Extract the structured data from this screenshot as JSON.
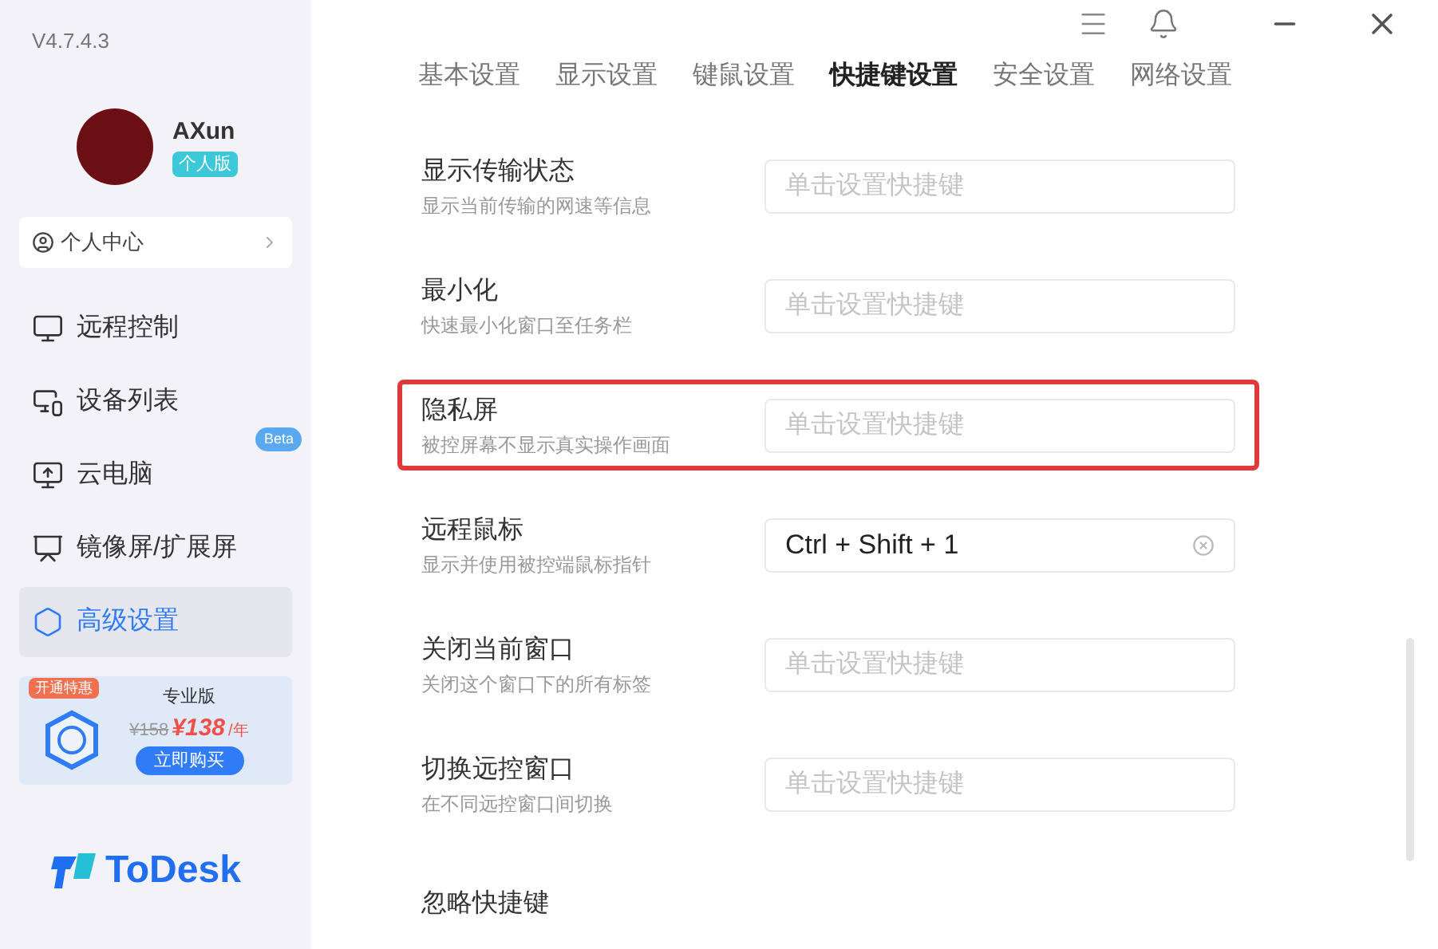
{
  "version": "V4.7.4.3",
  "user": {
    "name": "AXun",
    "badge": "个人版"
  },
  "personal_center": {
    "label": "个人中心"
  },
  "nav": [
    {
      "label": "远程控制",
      "selected": false
    },
    {
      "label": "设备列表",
      "selected": false
    },
    {
      "label": "云电脑",
      "selected": false,
      "badge": "Beta"
    },
    {
      "label": "镜像屏/扩展屏",
      "selected": false
    },
    {
      "label": "高级设置",
      "selected": true
    }
  ],
  "promo": {
    "tag": "开通特惠",
    "title": "专业版",
    "old_price": "¥158",
    "price": "¥138",
    "unit": "/年",
    "button": "立即购买"
  },
  "logo": "ToDesk",
  "tabs": [
    {
      "label": "基本设置",
      "selected": false
    },
    {
      "label": "显示设置",
      "selected": false
    },
    {
      "label": "键鼠设置",
      "selected": false
    },
    {
      "label": "快捷键设置",
      "selected": true
    },
    {
      "label": "安全设置",
      "selected": false
    },
    {
      "label": "网络设置",
      "selected": false
    }
  ],
  "shortcuts": [
    {
      "title": "显示传输状态",
      "desc": "显示当前传输的网速等信息",
      "placeholder": "单击设置快捷键",
      "highlighted": false
    },
    {
      "title": "最小化",
      "desc": "快速最小化窗口至任务栏",
      "placeholder": "单击设置快捷键",
      "highlighted": false
    },
    {
      "title": "隐私屏",
      "desc": "被控屏幕不显示真实操作画面",
      "placeholder": "单击设置快捷键",
      "highlighted": true
    },
    {
      "title": "远程鼠标",
      "desc": "显示并使用被控端鼠标指针",
      "value": "Ctrl + Shift + 1",
      "highlighted": false
    },
    {
      "title": "关闭当前窗口",
      "desc": "关闭这个窗口下的所有标签",
      "placeholder": "单击设置快捷键",
      "highlighted": false
    },
    {
      "title": "切换远控窗口",
      "desc": "在不同远控窗口间切换",
      "placeholder": "单击设置快捷键",
      "highlighted": false
    },
    {
      "title": "忽略快捷键",
      "highlighted": false
    }
  ]
}
